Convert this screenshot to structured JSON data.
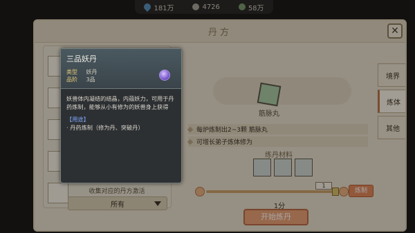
{
  "resources": [
    {
      "icon": "water-drop-icon",
      "value": "181万"
    },
    {
      "icon": "spirit-stone-icon",
      "value": "4726"
    },
    {
      "icon": "leaf-icon",
      "value": "58万"
    }
  ],
  "panel": {
    "title": "丹方",
    "close_label": "✕"
  },
  "left": {
    "hint": "收集对应的丹方激活",
    "filter": "所有"
  },
  "recipe": {
    "name": "筋脉丸",
    "effects": [
      "每炉炼制出2~3颗 筋脉丸",
      "可增长弟子炼体修为"
    ],
    "materials_title": "练丹材料",
    "count": "1",
    "time": "1分",
    "start_label": "开始炼丹",
    "alchemy_label": "炼制"
  },
  "side_tabs": [
    "境界",
    "炼体",
    "其他"
  ],
  "tooltip": {
    "title": "三品妖丹",
    "type_label": "类型",
    "type_value": "妖丹",
    "grade_label": "品阶",
    "grade_value": "3品",
    "description": "妖兽体内凝结的结晶，内蕴妖力，可用于丹药炼制，能够从小有修为的妖兽身上获得",
    "use_title": "【用途】",
    "use_text": "· 丹药炼制（修为丹、突破丹）"
  }
}
